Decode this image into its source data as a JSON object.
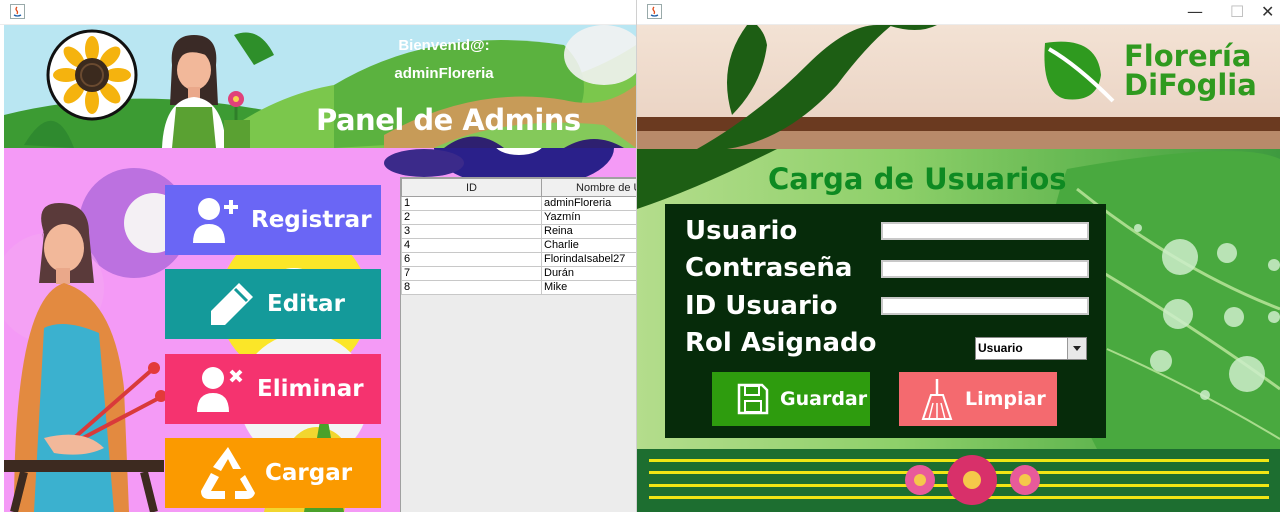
{
  "left_window": {
    "welcome_line1": "Bienvenid@:",
    "welcome_user": "adminFloreria",
    "title": "Panel de Admins",
    "buttons": {
      "registrar": "Registrar",
      "editar": "Editar",
      "eliminar": "Eliminar",
      "cargar": "Cargar"
    },
    "button_colors": [
      "#6a66f5",
      "#149a9a",
      "#f5336f",
      "#fb9a00"
    ],
    "table": {
      "columns": [
        "ID",
        "Nombre de Us"
      ],
      "rows": [
        [
          "1",
          "adminFloreria"
        ],
        [
          "2",
          "Yazmín"
        ],
        [
          "3",
          "Reina"
        ],
        [
          "4",
          "Charlie"
        ],
        [
          "6",
          "FlorindaIsabel27"
        ],
        [
          "7",
          "Durán"
        ],
        [
          "8",
          "Mike"
        ]
      ]
    }
  },
  "right_window": {
    "brand_line1": "Florería",
    "brand_line2": "DiFoglia",
    "title": "Carga de Usuarios",
    "fields": {
      "usuario_label": "Usuario",
      "contrasena_label": "Contraseña",
      "id_label": "ID Usuario",
      "rol_label": "Rol Asignado"
    },
    "inputs": {
      "usuario_value": "",
      "contrasena_value": "",
      "id_value": ""
    },
    "rol_select_value": "Usuario",
    "guardar_label": "Guardar",
    "limpiar_label": "Limpiar",
    "guardar_color": "#2e9c0e",
    "limpiar_color": "#f46a6f",
    "window_controls": [
      "—",
      "☐",
      "✕"
    ]
  },
  "icons": [
    "java-icon",
    "sunflower-icon",
    "gardener-avatar-icon",
    "add-user-icon",
    "pencil-icon",
    "remove-user-icon",
    "recycle-icon",
    "leaf-logo-icon",
    "floppy-disk-icon",
    "broom-icon"
  ]
}
